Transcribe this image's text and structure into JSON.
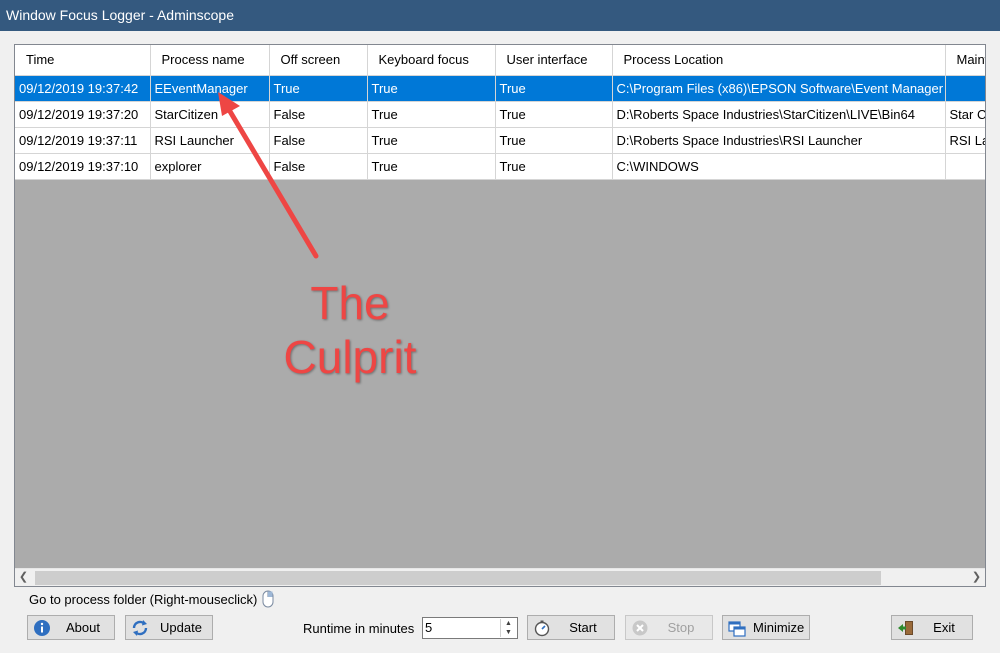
{
  "window": {
    "title": "Window Focus Logger - Adminscope"
  },
  "grid": {
    "columns": [
      "Time",
      "Process name",
      "Off screen",
      "Keyboard focus",
      "User interface",
      "Process Location",
      "Mainw"
    ],
    "rows": [
      [
        "09/12/2019 19:37:42",
        "EEventManager",
        "True",
        "True",
        "True",
        "C:\\Program Files (x86)\\EPSON Software\\Event Manager",
        ""
      ],
      [
        "09/12/2019 19:37:20",
        "StarCitizen",
        "False",
        "True",
        "True",
        "D:\\Roberts Space Industries\\StarCitizen\\LIVE\\Bin64",
        "Star Ci"
      ],
      [
        "09/12/2019 19:37:11",
        "RSI Launcher",
        "False",
        "True",
        "True",
        "D:\\Roberts Space Industries\\RSI Launcher",
        "RSI La"
      ],
      [
        "09/12/2019 19:37:10",
        "explorer",
        "False",
        "True",
        "True",
        "C:\\WINDOWS",
        ""
      ]
    ],
    "selected_row": 0
  },
  "annotation": {
    "line1": "The",
    "line2": "Culprit",
    "color": "#ee4644"
  },
  "footer": {
    "hint": "Go to process folder (Right-mouseclick)",
    "about_label": "About",
    "update_label": "Update",
    "runtime_label": "Runtime in minutes",
    "runtime_value": "5",
    "start_label": "Start",
    "stop_label": "Stop",
    "minimize_label": "Minimize",
    "exit_label": "Exit"
  },
  "colors": {
    "titlebar": "#34597f",
    "selection": "#0078d7",
    "grid_bg": "#ababab"
  }
}
